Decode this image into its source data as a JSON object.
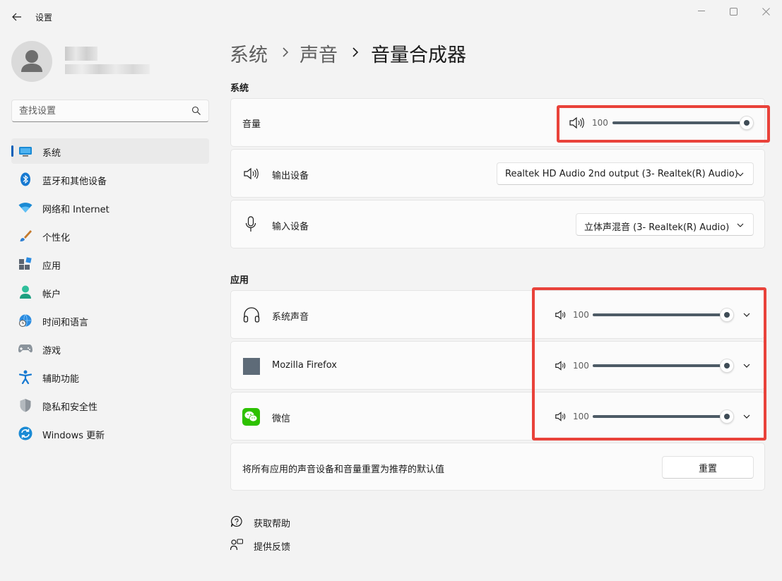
{
  "window": {
    "title": "设置"
  },
  "profile": {},
  "search": {
    "placeholder": "查找设置"
  },
  "nav": {
    "items": [
      {
        "label": "系统",
        "icon": "monitor-icon",
        "active": true
      },
      {
        "label": "蓝牙和其他设备",
        "icon": "bluetooth-icon"
      },
      {
        "label": "网络和 Internet",
        "icon": "wifi-icon"
      },
      {
        "label": "个性化",
        "icon": "brush-icon"
      },
      {
        "label": "应用",
        "icon": "apps-icon"
      },
      {
        "label": "帐户",
        "icon": "account-icon"
      },
      {
        "label": "时间和语言",
        "icon": "globe-clock-icon"
      },
      {
        "label": "游戏",
        "icon": "gamepad-icon"
      },
      {
        "label": "辅助功能",
        "icon": "accessibility-icon"
      },
      {
        "label": "隐私和安全性",
        "icon": "shield-icon"
      },
      {
        "label": "Windows 更新",
        "icon": "update-icon"
      }
    ]
  },
  "breadcrumb": {
    "level1": "系统",
    "level2": "声音",
    "current": "音量合成器"
  },
  "system_section": {
    "title": "系统",
    "volume": {
      "label": "音量",
      "value": "100",
      "level": 1.0
    },
    "output": {
      "label": "输出设备",
      "selected": "Realtek HD Audio 2nd output (3- Realtek(R) Audio)"
    },
    "input": {
      "label": "输入设备",
      "selected": "立体声混音 (3- Realtek(R) Audio)"
    }
  },
  "apps_section": {
    "title": "应用",
    "apps": [
      {
        "name": "系统声音",
        "icon": "headphones-icon",
        "value": "100",
        "level": 1.0
      },
      {
        "name": "Mozilla Firefox",
        "icon": "app-placeholder-icon",
        "value": "100",
        "level": 1.0
      },
      {
        "name": "微信",
        "icon": "wechat-icon",
        "value": "100",
        "level": 1.0
      }
    ]
  },
  "reset": {
    "description": "将所有应用的声音设备和音量重置为推荐的默认值",
    "button_label": "重置"
  },
  "footer": {
    "help": "获取帮助",
    "feedback": "提供反馈"
  },
  "colors": {
    "accent": "#005fb8",
    "slider": "#4d5b66",
    "highlight_box": "#e9423a"
  }
}
